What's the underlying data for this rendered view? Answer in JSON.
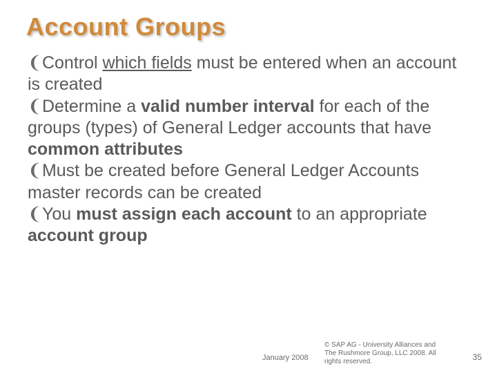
{
  "title": "Account Groups",
  "bullets": {
    "b1_pre": "Control ",
    "b1_u": "which fields",
    "b1_post": " must be entered when an account is created",
    "b2_pre": "Determine a ",
    "b2_bold1": "valid number interval",
    "b2_mid": " for each of the groups (types) of General Ledger accounts that have ",
    "b2_bold2": "common attributes",
    "b3": "Must be created before General Ledger Accounts master records can be created",
    "b4_pre": "You ",
    "b4_bold1": "must assign each account",
    "b4_mid": " to an appropriate ",
    "b4_bold2": "account group"
  },
  "glyph": "❨",
  "footer": {
    "date": "January 2008",
    "copyright": "© SAP AG - University Alliances and The Rushmore Group, LLC 2008. All rights reserved.",
    "page": "35"
  }
}
